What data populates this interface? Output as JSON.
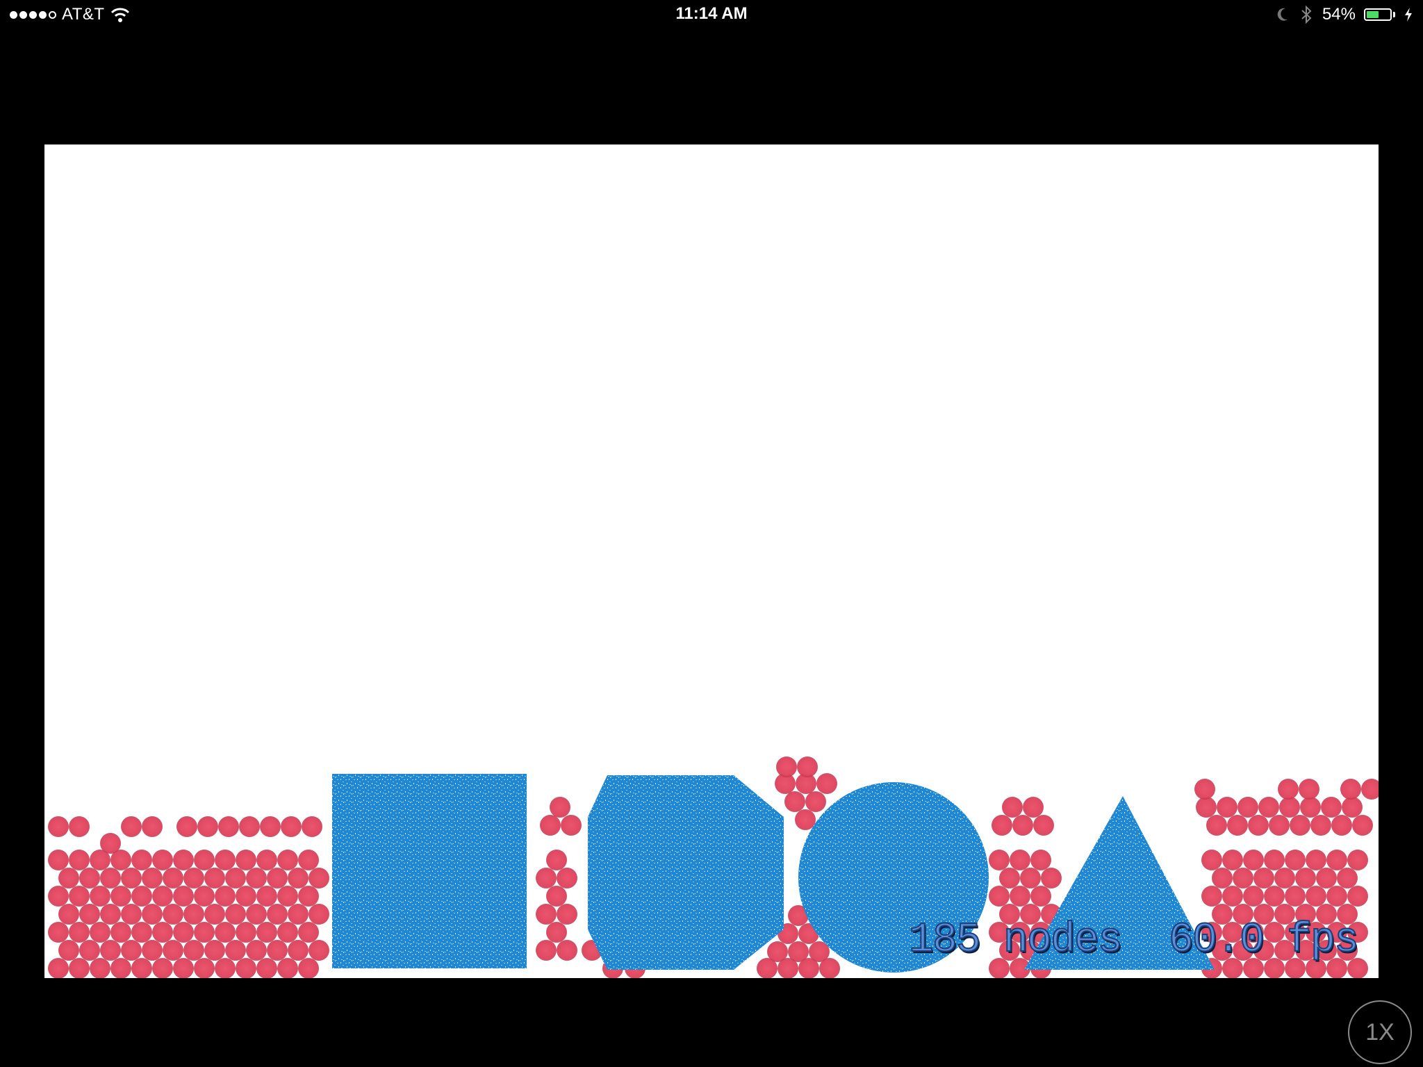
{
  "status_bar": {
    "signal_bars_filled": 4,
    "signal_bars_total": 5,
    "carrier": "AT&T",
    "time": "11:14 AM",
    "battery_percent": "54%",
    "battery_level": 0.54,
    "icons": [
      "wifi-icon",
      "moon-icon",
      "bluetooth-icon",
      "battery-icon",
      "charging-bolt-icon"
    ]
  },
  "game": {
    "hud": {
      "node_count": "185",
      "nodes_label": "nodes",
      "fps_value": "60.0",
      "fps_label": "fps"
    },
    "colors": {
      "background": "#ffffff",
      "ball": "#e34a63",
      "ball_edge": "#c7334c",
      "shape": "#1f88d6",
      "shape_light": "#8cc4ee",
      "hud_text": "#5b8fd8",
      "hud_outline": "#1c3f7a"
    },
    "shapes": [
      "square",
      "octagon",
      "circle",
      "triangle"
    ]
  },
  "controls": {
    "speed_label": "1X"
  }
}
